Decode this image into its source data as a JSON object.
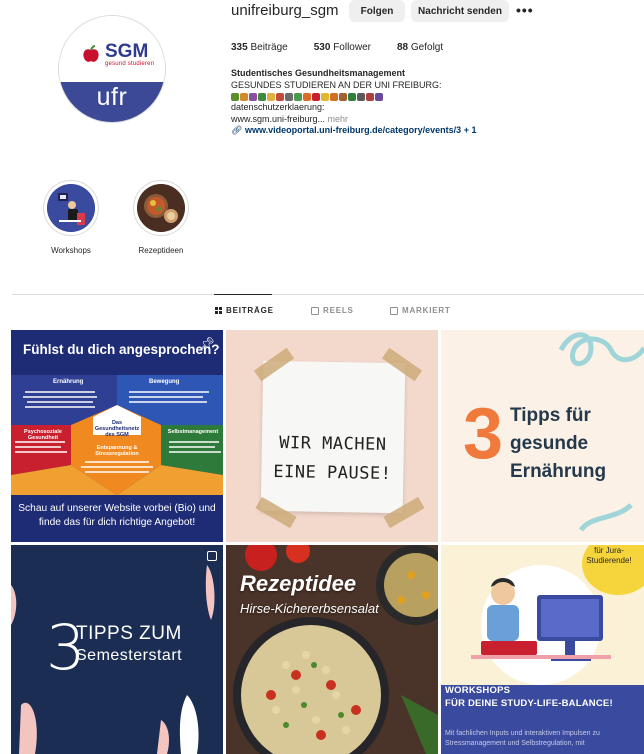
{
  "profile": {
    "username": "unifreiburg_sgm",
    "follow_label": "Folgen",
    "message_label": "Nachricht senden",
    "more_label": "•••",
    "avatar": {
      "logo": "SGM",
      "logo_sub": "gesund studieren",
      "text": "ufr"
    },
    "stats": {
      "posts": "335",
      "posts_label": "Beiträge",
      "followers": "530",
      "followers_label": "Follower",
      "following": "88",
      "following_label": "Gefolgt"
    },
    "bio": {
      "name": "Studentisches Gesundheitsmanagement",
      "line1": "GESUNDES STUDIEREN AN DER UNI FREIBURG:",
      "line3": "datenschutzerklaerung:",
      "line4": "www.sgm.uni-freiburg...",
      "more": "mehr",
      "link": "www.videoportal.uni-freiburg.de/category/events/3",
      "link_extra": "+ 1"
    }
  },
  "highlights": [
    {
      "label": "Workshops"
    },
    {
      "label": "Rezeptideen"
    }
  ],
  "tabs": [
    {
      "label": "BEITRÄGE",
      "active": true
    },
    {
      "label": "REELS",
      "active": false
    },
    {
      "label": "MARKIERT",
      "active": false
    }
  ],
  "posts": {
    "p1": {
      "title": "Fühlst du dich angesprochen?",
      "q1": "Ernährung",
      "q2": "Bewegung",
      "q3": "Psychosoziale Gesundheit",
      "q4": "Das Gesundheitsnetz des SGM",
      "q5": "Selbstmanagement",
      "q6": "Entspannung & Stressregulation",
      "footer": "Schau auf unserer Website vorbei (Bio) und finde das für dich richtige Angebot!"
    },
    "p2": {
      "line1": "WIR MACHEN",
      "line2": "EINE PAUSE!"
    },
    "p3": {
      "number": "3",
      "line1": "Tipps für",
      "line2": "gesunde",
      "line3": "Ernährung"
    },
    "p4": {
      "number": "3",
      "line1": "TIPPS ZUM",
      "line2": "Semesterstart"
    },
    "p5": {
      "title": "Rezeptidee",
      "subtitle": "Hirse-Kichererbsensalat"
    },
    "p6": {
      "badge": "für Jura-Studierende!",
      "line1": "WORKSHOPS",
      "line2": "FÜR DEINE STUDY-LIFE-BALANCE!",
      "small": "Mit fachlichen Inputs und interaktiven Impulsen zu Stressmanagement und Selbstregulation, mit"
    }
  },
  "colors": {
    "accent_blue": "#3b4996",
    "link": "#00376b",
    "orange": "#f07a3c"
  }
}
